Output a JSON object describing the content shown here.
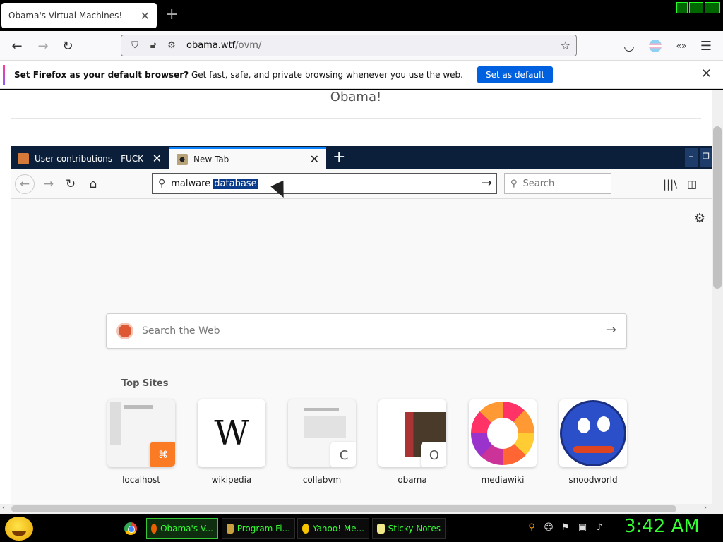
{
  "outer_browser": {
    "tab_title": "Obama's Virtual Machines!",
    "address": {
      "domain": "obama.wtf",
      "path": "/ovm/"
    },
    "infobar": {
      "bold": "Set Firefox as your default browser?",
      "text": " Get fast, safe, and private browsing whenever you use the web.",
      "button": "Set as default"
    },
    "page_title": "Obama!"
  },
  "vm_browser": {
    "tabs": [
      {
        "label": "User contributions - FUCK"
      },
      {
        "label": "New Tab"
      }
    ],
    "address_input": {
      "typed": "malware ",
      "selected": "database"
    },
    "search_placeholder": "Search",
    "web_search_placeholder": "Search the Web",
    "top_sites_heading": "Top Sites",
    "top_sites": [
      {
        "label": "localhost",
        "badge_icon": "xampp-icon"
      },
      {
        "label": "wikipedia",
        "letter": "W"
      },
      {
        "label": "collabvm",
        "badge": "C"
      },
      {
        "label": "obama",
        "badge": "O"
      },
      {
        "label": "mediawiki",
        "icon": "mediawiki-sunflower-icon"
      },
      {
        "label": "snoodworld",
        "icon": "snood-face-icon"
      }
    ]
  },
  "taskbar": {
    "items": [
      {
        "label": "Obama's V...",
        "active": true
      },
      {
        "label": "Program Fi..."
      },
      {
        "label": "Yahoo! Me..."
      },
      {
        "label": "Sticky Notes"
      }
    ],
    "clock": "3:42 AM"
  },
  "colors": {
    "vm_tabbar": "#0c1f3a",
    "accent_blue": "#0061e0",
    "taskbar_text": "#33ff33"
  }
}
